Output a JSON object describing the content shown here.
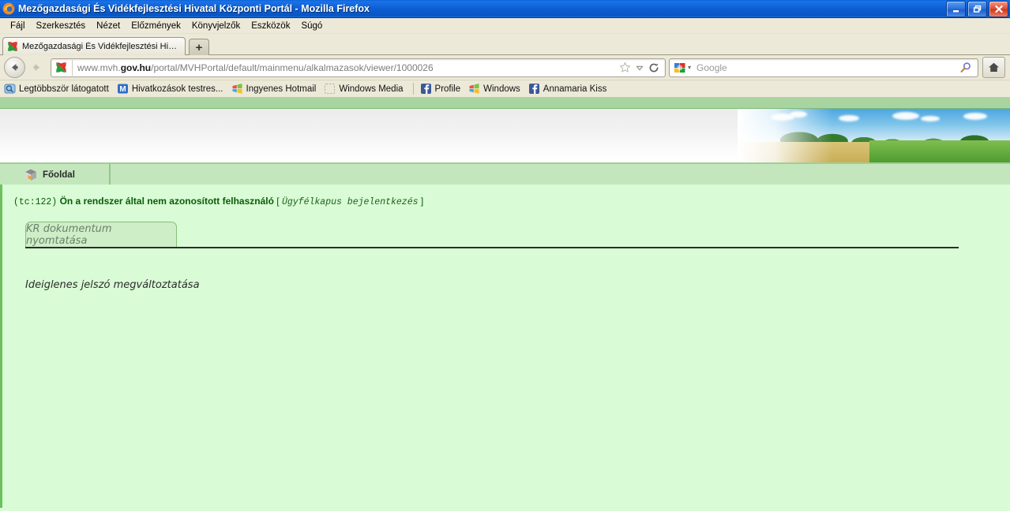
{
  "window": {
    "title": "Mezőgazdasági És Vidékfejlesztési Hivatal Központi Portál - Mozilla Firefox",
    "app_icon": "firefox-icon",
    "minimize_label": "_",
    "restore_label": "❐",
    "close_label": "✕"
  },
  "menubar": {
    "items": [
      {
        "label": "Fájl",
        "accel": "F"
      },
      {
        "label": "Szerkesztés",
        "accel": "z"
      },
      {
        "label": "Nézet",
        "accel": "N"
      },
      {
        "label": "Előzmények",
        "accel": "z"
      },
      {
        "label": "Könyvjelzők",
        "accel": "j"
      },
      {
        "label": "Eszközök",
        "accel": "E"
      },
      {
        "label": "Súgó",
        "accel": "S"
      }
    ]
  },
  "tabstrip": {
    "tab_title": "Mezőgazdasági És Vidékfejlesztési Hivatal K...",
    "tab_favicon": "mvh-logo-icon",
    "new_tab_label": "+"
  },
  "navbar": {
    "back_icon": "back-arrow-icon",
    "forward_icon": "forward-arrow-icon",
    "site_favicon": "mvh-logo-icon",
    "url_prefix": "www.mvh.",
    "url_domain": "gov.hu",
    "url_path": "/portal/MVHPortal/default/mainmenu/alkalmazasok/viewer/1000026",
    "bookmark_icon": "star-icon",
    "dropdown_icon": "chevron-down-icon",
    "reload_icon": "reload-icon",
    "search_engine": "google-icon",
    "search_placeholder": "Google",
    "search_icon": "magnifier-icon",
    "home_icon": "home-icon"
  },
  "bookmarks": {
    "items": [
      {
        "label": "Legtöbbször látogatott",
        "icon": "most-visited-icon"
      },
      {
        "label": "Hivatkozások testres...",
        "icon": "customize-links-icon"
      },
      {
        "label": "Ingyenes Hotmail",
        "icon": "windows-icon"
      },
      {
        "label": "Windows Media",
        "icon": "windows-media-icon"
      },
      {
        "label": "Profile",
        "icon": "facebook-icon"
      },
      {
        "label": "Windows",
        "icon": "windows-icon"
      },
      {
        "label": "Annamaria Kiss",
        "icon": "facebook-icon"
      }
    ]
  },
  "portal": {
    "banner_image": "farmland-landscape-photo",
    "nav": {
      "home_tab_label": "Főoldal",
      "home_tab_icon": "cube-box-icon"
    },
    "status": {
      "code": "(tc:122)",
      "message": "Ön a rendszer által nem azonosított felhasználó",
      "bracket_open": "[",
      "login_link": "Ügyfélkapus bejelentkezés",
      "bracket_close": "]"
    },
    "tabs": [
      {
        "label": "KR dokumentum nyomtatása",
        "active": true
      }
    ],
    "links": [
      {
        "label": "Ideiglenes jelszó megváltoztatása"
      }
    ]
  },
  "colors": {
    "titlebar_blue": "#0c5fd3",
    "chrome_bg": "#ece9d8",
    "portal_green_bg": "#d9fbd5",
    "portal_nav_green": "#c4e6bd",
    "portal_strip_green": "#a8d4a0",
    "status_text_green": "#0a5c0a",
    "close_red": "#cc3a22"
  }
}
